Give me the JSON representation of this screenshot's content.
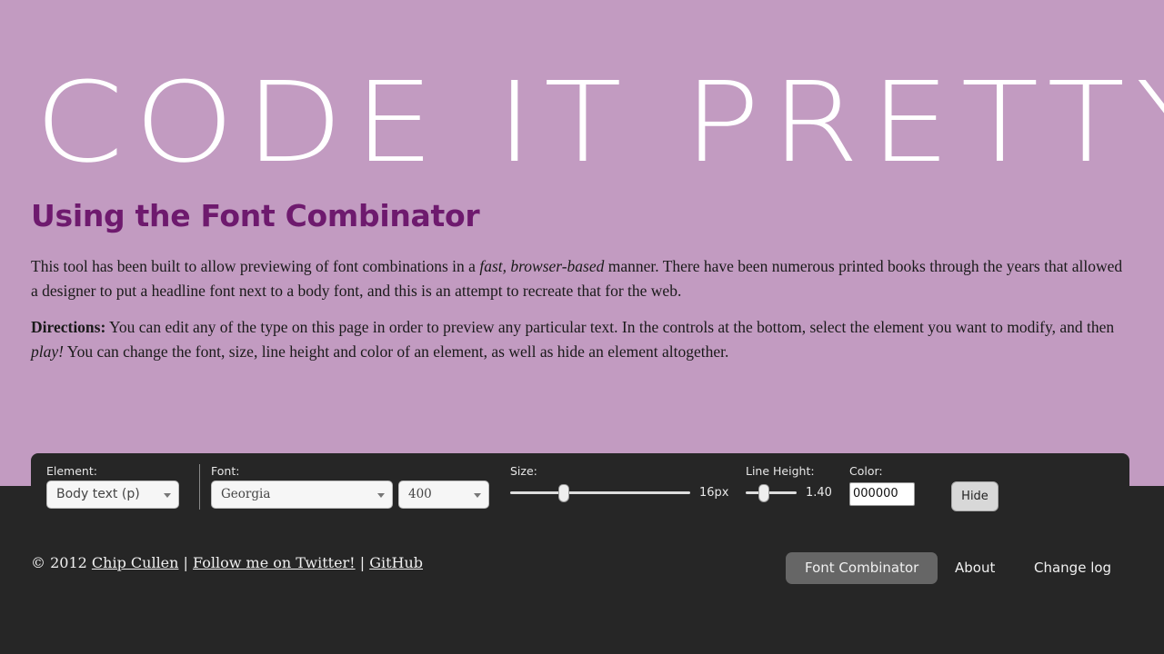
{
  "site": {
    "title_word1": "CODE",
    "title_word2": "IT",
    "title_word3": "PRETTY"
  },
  "headline": "Using the Font Combinator",
  "intro": {
    "part1": "This tool has been built to allow previewing of font combinations in a ",
    "emphasis": "fast, browser-based",
    "part2": " manner. There have been numerous printed books through the years that allowed a designer to put a headline font next to a body font, and this is an attempt to recreate that for the web."
  },
  "directions": {
    "label": "Directions:",
    "part1": " You can edit any of the type on this page in order to preview any particular text. In the controls at the bottom, select the element you want to modify, and then ",
    "emphasis": "play!",
    "part2": " You can change the font, size, line height and color of an element, as well as hide an element altogether."
  },
  "controls": {
    "element_label": "Element:",
    "element_value": "Body text (p)",
    "font_label": "Font:",
    "font_value": "Georgia",
    "weight_value": "400",
    "size_label": "Size:",
    "size_value": "16px",
    "size_slider_fraction": 0.3,
    "line_height_label": "Line Height:",
    "line_height_value": "1.40",
    "line_height_slider_fraction": 0.35,
    "color_label": "Color:",
    "color_value": "000000",
    "hide_label": "Hide"
  },
  "footer": {
    "copyright": "© 2012",
    "author_link": "Chip Cullen",
    "sep": "|",
    "twitter_link": "Follow me on Twitter!",
    "github_link": "GitHub"
  },
  "nav": {
    "items": [
      {
        "label": "Font Combinator",
        "active": true
      },
      {
        "label": "About",
        "active": false
      },
      {
        "label": "Change log",
        "active": false
      }
    ]
  },
  "colors": {
    "background": "#c29bc1",
    "headline": "#6e1a6e",
    "footer": "#262626"
  }
}
